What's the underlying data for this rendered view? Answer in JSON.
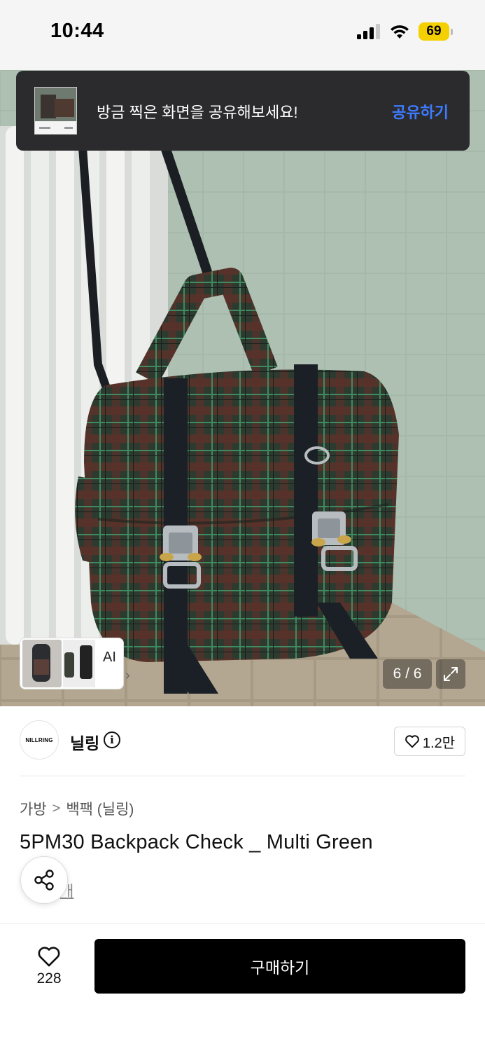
{
  "status_bar": {
    "time": "10:44",
    "battery": "69",
    "icons": [
      "signal-icon",
      "wifi-icon",
      "battery-icon"
    ]
  },
  "toast": {
    "message": "방금 찍은 화면을 공유해보세요!",
    "action": "공유하기",
    "action_color": "#3d7bff"
  },
  "gallery": {
    "ai_label": "AI",
    "ai_chevron": "›",
    "counter": "6 / 6"
  },
  "brand": {
    "logo_text": "NILLRING",
    "name": "닐링",
    "info_glyph": "i",
    "likes": "1.2만"
  },
  "breadcrumb": {
    "items": [
      "가방",
      "백팩 (닐링)"
    ],
    "separator": ">"
  },
  "product": {
    "title": "5PM30 Backpack Check _ Multi Green",
    "partial_link": "개"
  },
  "bottom_bar": {
    "like_count": "228",
    "buy_label": "구매하기"
  }
}
